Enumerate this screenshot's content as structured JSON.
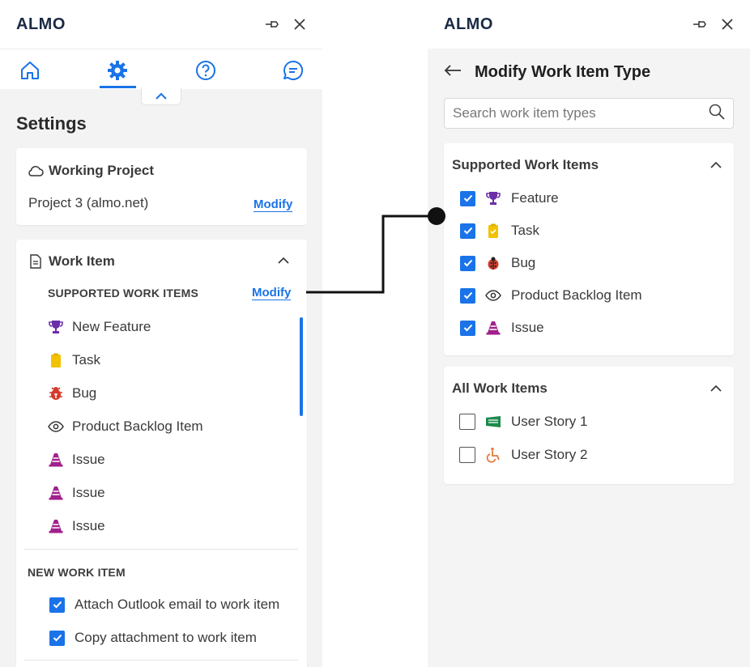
{
  "left": {
    "logo": "ALMO",
    "title": "Settings",
    "working_project": {
      "label": "Working Project",
      "value": "Project 3 (almo.net)",
      "modify": "Modify"
    },
    "work_item": {
      "label": "Work Item",
      "supported_header": "SUPPORTED WORK ITEMS",
      "modify": "Modify",
      "items": [
        {
          "label": "New Feature",
          "icon": "trophy-icon"
        },
        {
          "label": "Task",
          "icon": "clipboard-icon"
        },
        {
          "label": "Bug",
          "icon": "bug-icon"
        },
        {
          "label": "Product Backlog Item",
          "icon": "eye-icon"
        },
        {
          "label": "Issue",
          "icon": "cone-icon"
        },
        {
          "label": "Issue",
          "icon": "cone-icon"
        },
        {
          "label": "Issue",
          "icon": "cone-icon"
        }
      ],
      "new_header": "NEW WORK ITEM",
      "options": [
        {
          "label": "Attach Outlook email to work item",
          "checked": true
        },
        {
          "label": "Copy attachment to work item",
          "checked": true
        }
      ]
    }
  },
  "right": {
    "logo": "ALMO",
    "title": "Modify Work Item Type",
    "search_placeholder": "Search work item types",
    "supported": {
      "label": "Supported Work Items",
      "items": [
        {
          "label": "Feature",
          "icon": "trophy-icon",
          "checked": true
        },
        {
          "label": "Task",
          "icon": "clipboard-icon",
          "checked": true
        },
        {
          "label": "Bug",
          "icon": "ladybug-icon",
          "checked": true
        },
        {
          "label": "Product Backlog Item",
          "icon": "eye-icon",
          "checked": true
        },
        {
          "label": "Issue",
          "icon": "cone-icon",
          "checked": true
        }
      ]
    },
    "all": {
      "label": "All Work Items",
      "items": [
        {
          "label": "User Story 1",
          "icon": "flag-icon",
          "checked": false
        },
        {
          "label": "User Story 2",
          "icon": "wheelchair-icon",
          "checked": false
        }
      ]
    }
  },
  "colors": {
    "accent": "#1a73e8",
    "trophy": "#6b2fa8",
    "clipboard": "#f2c200",
    "bug": "#d43a2a",
    "cone": "#a0218c",
    "flag": "#1e8a4c",
    "wheelchair": "#e5793a"
  }
}
